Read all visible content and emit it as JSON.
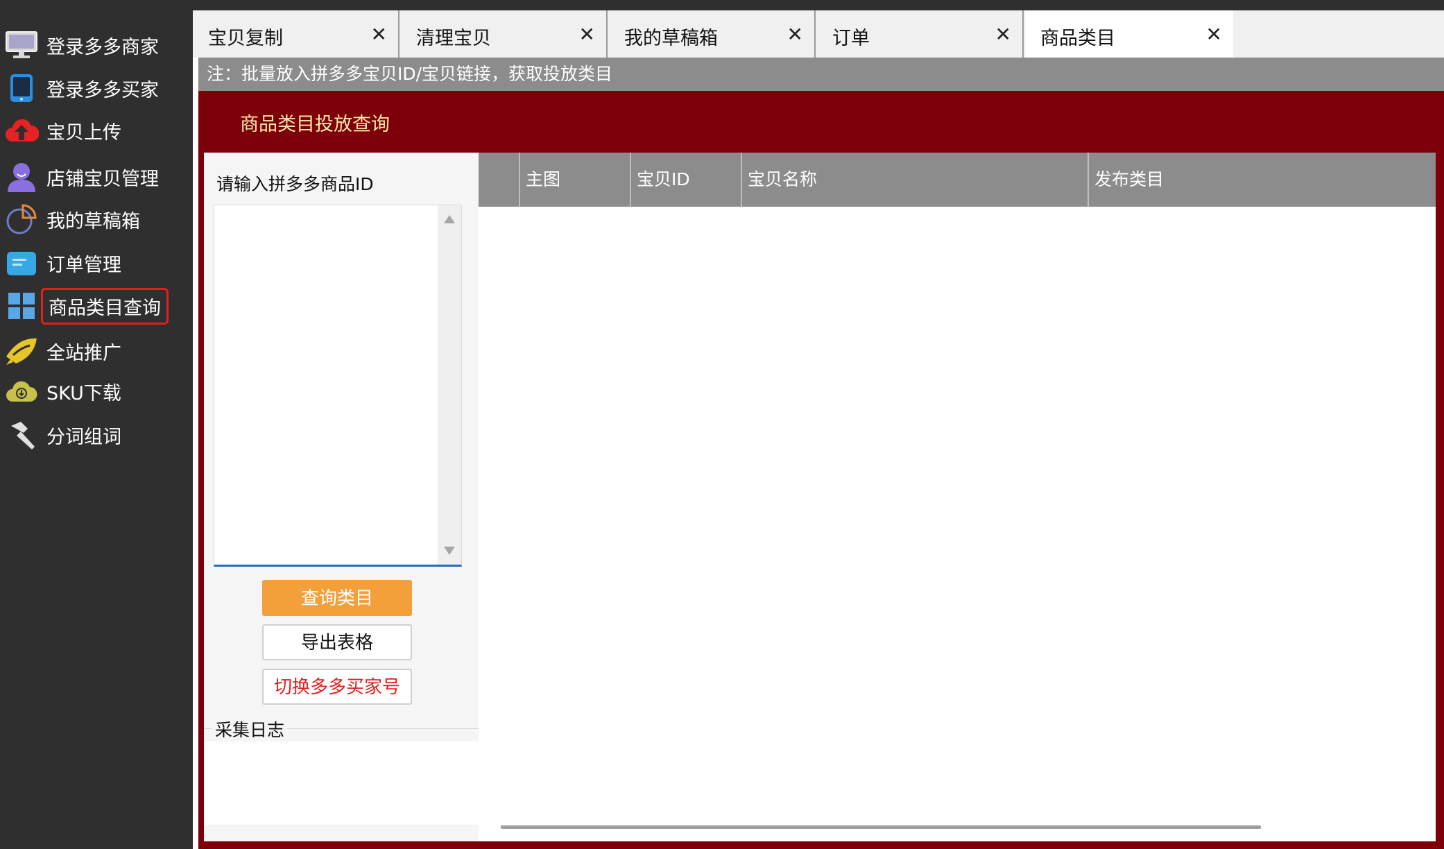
{
  "sidebar": {
    "items": [
      {
        "label": "登录多多商家",
        "icon": "monitor-icon"
      },
      {
        "label": "登录多多买家",
        "icon": "tablet-icon"
      },
      {
        "label": "宝贝上传",
        "icon": "cloud-upload-icon"
      },
      {
        "label": "店铺宝贝管理",
        "icon": "user-icon"
      },
      {
        "label": "我的草稿箱",
        "icon": "pie-chart-icon"
      },
      {
        "label": "订单管理",
        "icon": "folder-icon"
      },
      {
        "label": "商品类目查询",
        "icon": "grid-icon",
        "active": true
      },
      {
        "label": "全站推广",
        "icon": "rocket-icon"
      },
      {
        "label": "SKU下载",
        "icon": "cloud-download-icon"
      },
      {
        "label": "分词组词",
        "icon": "hammer-icon"
      }
    ]
  },
  "tabs": [
    {
      "label": "宝贝复制"
    },
    {
      "label": "清理宝贝"
    },
    {
      "label": "我的草稿箱"
    },
    {
      "label": "订单"
    },
    {
      "label": "商品类目",
      "active": true
    }
  ],
  "tab_close_glyph": "✕",
  "notice": "注：批量放入拼多多宝贝ID/宝贝链接，获取投放类目",
  "page_heading": "商品类目投放查询",
  "left_panel": {
    "input_label": "请输入拼多多商品ID",
    "input_value": "",
    "query_button": "查询类目",
    "export_button": "导出表格",
    "switch_button": "切换多多买家号",
    "log_label": "采集日志"
  },
  "grid": {
    "columns": [
      "",
      "主图",
      "宝贝ID",
      "宝贝名称",
      "发布类目"
    ],
    "rows": []
  },
  "colors": {
    "frame": "#7d0008",
    "accent_orange": "#f4a03a",
    "sidebar_bg": "#2f2f2f",
    "active_outline": "#e0201b",
    "switch_text": "#e01e1e"
  }
}
